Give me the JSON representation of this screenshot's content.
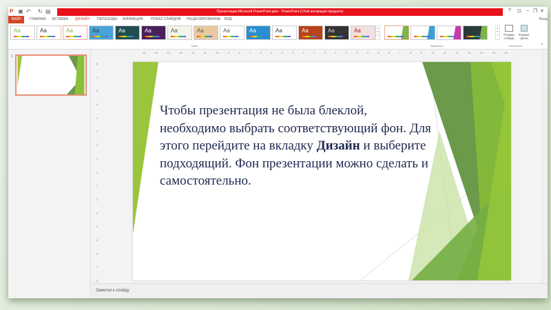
{
  "window": {
    "title": "Презентация Microsoft PowerPoint.pptx - PowerPoint (Сбой активации продукта)",
    "sign_in": "Вход",
    "help": "?"
  },
  "tabs": [
    "ФАЙЛ",
    "ГЛАВНАЯ",
    "ВСТАВКА",
    "ДИЗАЙН",
    "ПЕРЕХОДЫ",
    "АНИМАЦИЯ",
    "ПОКАЗ СЛАЙДОВ",
    "РЕЦЕНЗИРОВАНИЕ",
    "ВИД"
  ],
  "active_tab": "ДИЗАЙН",
  "ribbon": {
    "themes_group": "Темы",
    "themes": [
      {
        "label": "Aa",
        "bg": "#ffffff",
        "fg": "#7ab648"
      },
      {
        "label": "Aa",
        "bg": "#ffffff",
        "fg": "#333333"
      },
      {
        "label": "Aa",
        "bg": "#ffffff",
        "fg": "#7ab648"
      },
      {
        "label": "Aa",
        "bg": "#4aa3d8",
        "fg": "#333333"
      },
      {
        "label": "Aa",
        "bg": "#1f4f4f",
        "fg": "#ffffff"
      },
      {
        "label": "Aa",
        "bg": "#4a1f5a",
        "fg": "#ffffff"
      },
      {
        "label": "Aa",
        "bg": "#f4f4ea",
        "fg": "#555555"
      },
      {
        "label": "Aa",
        "bg": "#e8c9a0",
        "fg": "#555555"
      },
      {
        "label": "Aa",
        "bg": "#ffffff",
        "fg": "#555555"
      },
      {
        "label": "Aa",
        "bg": "#2a8fd0",
        "fg": "#ffffff"
      },
      {
        "label": "Aa",
        "bg": "#ffffff",
        "fg": "#333333"
      },
      {
        "label": "Aa",
        "bg": "#b8421a",
        "fg": "#ffffff"
      },
      {
        "label": "Aa",
        "bg": "#333333",
        "fg": "#dddddd"
      },
      {
        "label": "Aa",
        "bg": "#f0e0e0",
        "fg": "#b01818"
      }
    ],
    "variants_group": "Варианты",
    "variants": [
      {
        "accent": "#7ab648",
        "bg": "#ffffff"
      },
      {
        "accent": "#3aa0d8",
        "bg": "#ffffff"
      },
      {
        "accent": "#c83aa8",
        "bg": "#ffffff"
      },
      {
        "accent": "#7ab648",
        "bg": "#2a3a3a"
      }
    ],
    "customize_group": "Настроить",
    "slide_size": "Размер слайда",
    "format_bg": "Формат фона"
  },
  "ruler_h": [
    "16",
    "15",
    "14",
    "13",
    "12",
    "11",
    "10",
    "9",
    "8",
    "7",
    "6",
    "5",
    "4",
    "3",
    "2",
    "1",
    "0",
    "1",
    "2",
    "3",
    "4",
    "5",
    "6",
    "7",
    "8",
    "9",
    "10",
    "11",
    "12",
    "13",
    "14",
    "15",
    "16"
  ],
  "ruler_v": [
    "8",
    "7",
    "6",
    "5",
    "4",
    "3",
    "2",
    "1",
    "0",
    "1",
    "2",
    "3",
    "4",
    "5",
    "6",
    "7",
    "8"
  ],
  "slide_panel": {
    "number": "1"
  },
  "slide": {
    "text_before": "Чтобы презентация не была блеклой, необходимо выбрать соответствующий фон. Для этого перейдите на вкладку ",
    "text_bold": "Дизайн",
    "text_after": " и выберите подходящий. Фон презентации можно сделать и самостоятельно."
  },
  "notes_placeholder": "Заметки к слайду",
  "colors": {
    "accent": "#d24726",
    "title_bar": "#e8101a",
    "slide_text": "#1f2850",
    "green": "#8dc03a"
  }
}
